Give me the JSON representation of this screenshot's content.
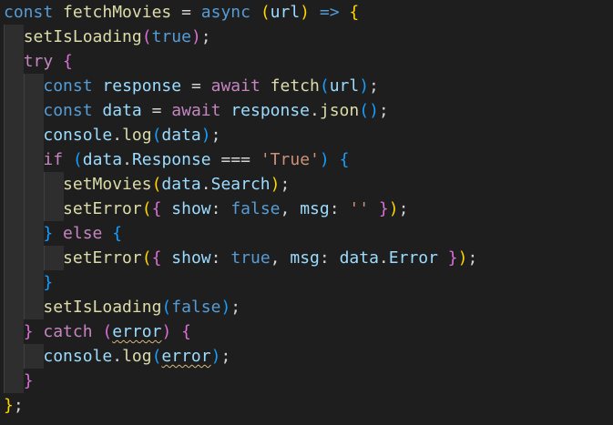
{
  "editor": {
    "lines": [
      "const fetchMovies = async (url) => {",
      "  setIsLoading(true);",
      "  try {",
      "    const response = await fetch(url);",
      "    const data = await response.json();",
      "    console.log(data);",
      "    if (data.Response === 'True') {",
      "      setMovies(data.Search);",
      "      setError({ show: false, msg: '' });",
      "    } else {",
      "      setError({ show: true, msg: data.Error });",
      "    }",
      "    setIsLoading(false);",
      "  } catch (error) {",
      "    console.log(error);",
      "  }",
      "};"
    ]
  },
  "colors": {
    "background": "#1e1e1e",
    "keyword": "#569cd6",
    "control_keyword": "#c586c0",
    "function": "#dcdcaa",
    "variable": "#9cdcfe",
    "string": "#ce9178",
    "bracket_level1": "#ffd700",
    "bracket_level2": "#da70d6",
    "bracket_level3": "#179fff"
  }
}
